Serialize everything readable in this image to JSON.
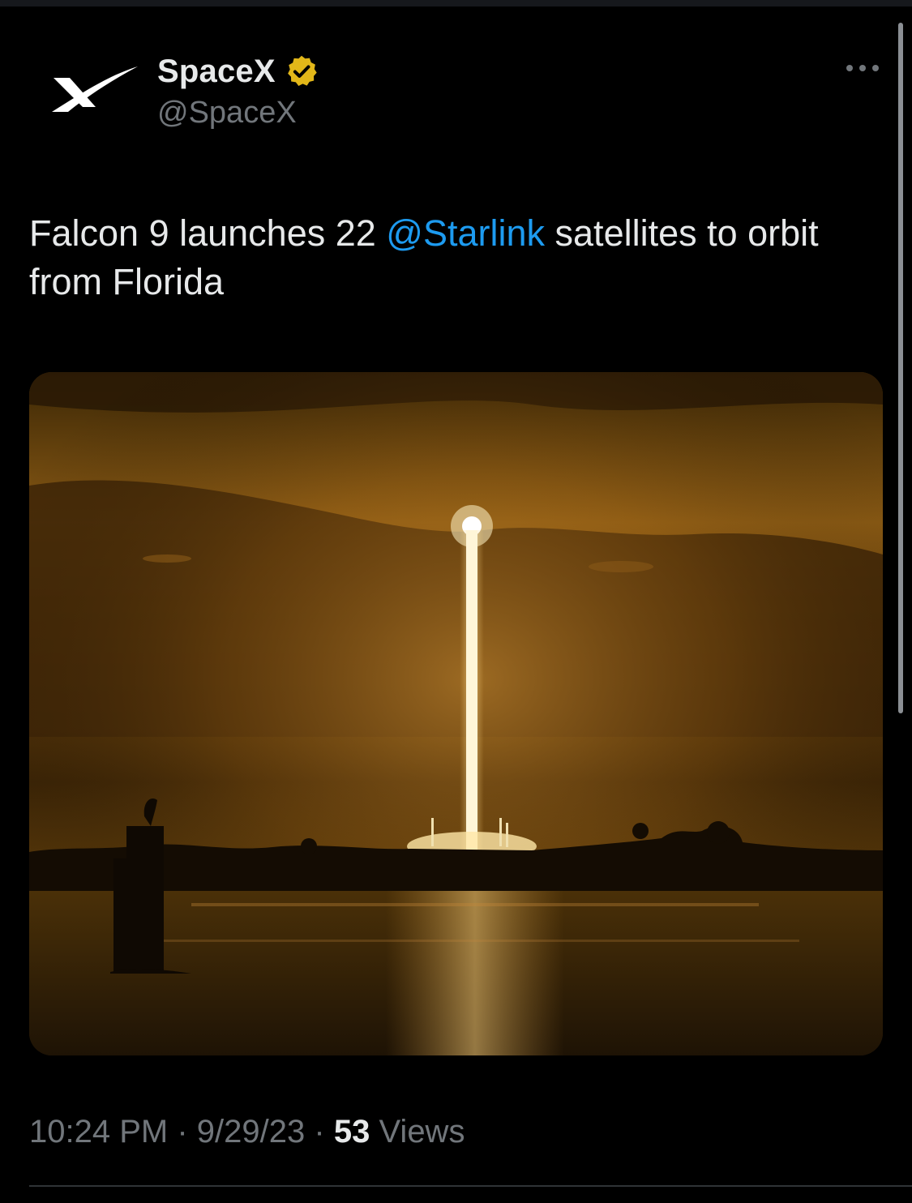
{
  "tweet": {
    "author": {
      "display_name": "SpaceX",
      "handle": "@SpaceX",
      "avatar_icon": "spacex-x-logo-icon",
      "verified_icon": "verified-badge-icon",
      "verified_color": "#e2b719"
    },
    "more_icon": "more-ellipsis-icon",
    "text": {
      "before_mention": "Falcon 9 launches 22 ",
      "mention": "@Starlink",
      "after_mention": " satellites to orbit from Florida"
    },
    "media": {
      "type": "photo",
      "alt": ""
    },
    "meta": {
      "time": "10:24 PM",
      "separator": "·",
      "date": "9/29/23",
      "views_count": "53",
      "views_label": "Views"
    }
  },
  "colors": {
    "background": "#000000",
    "text_primary": "#e7e9ea",
    "text_secondary": "#71767b",
    "link": "#1d9bf0",
    "divider": "#2f3336"
  }
}
